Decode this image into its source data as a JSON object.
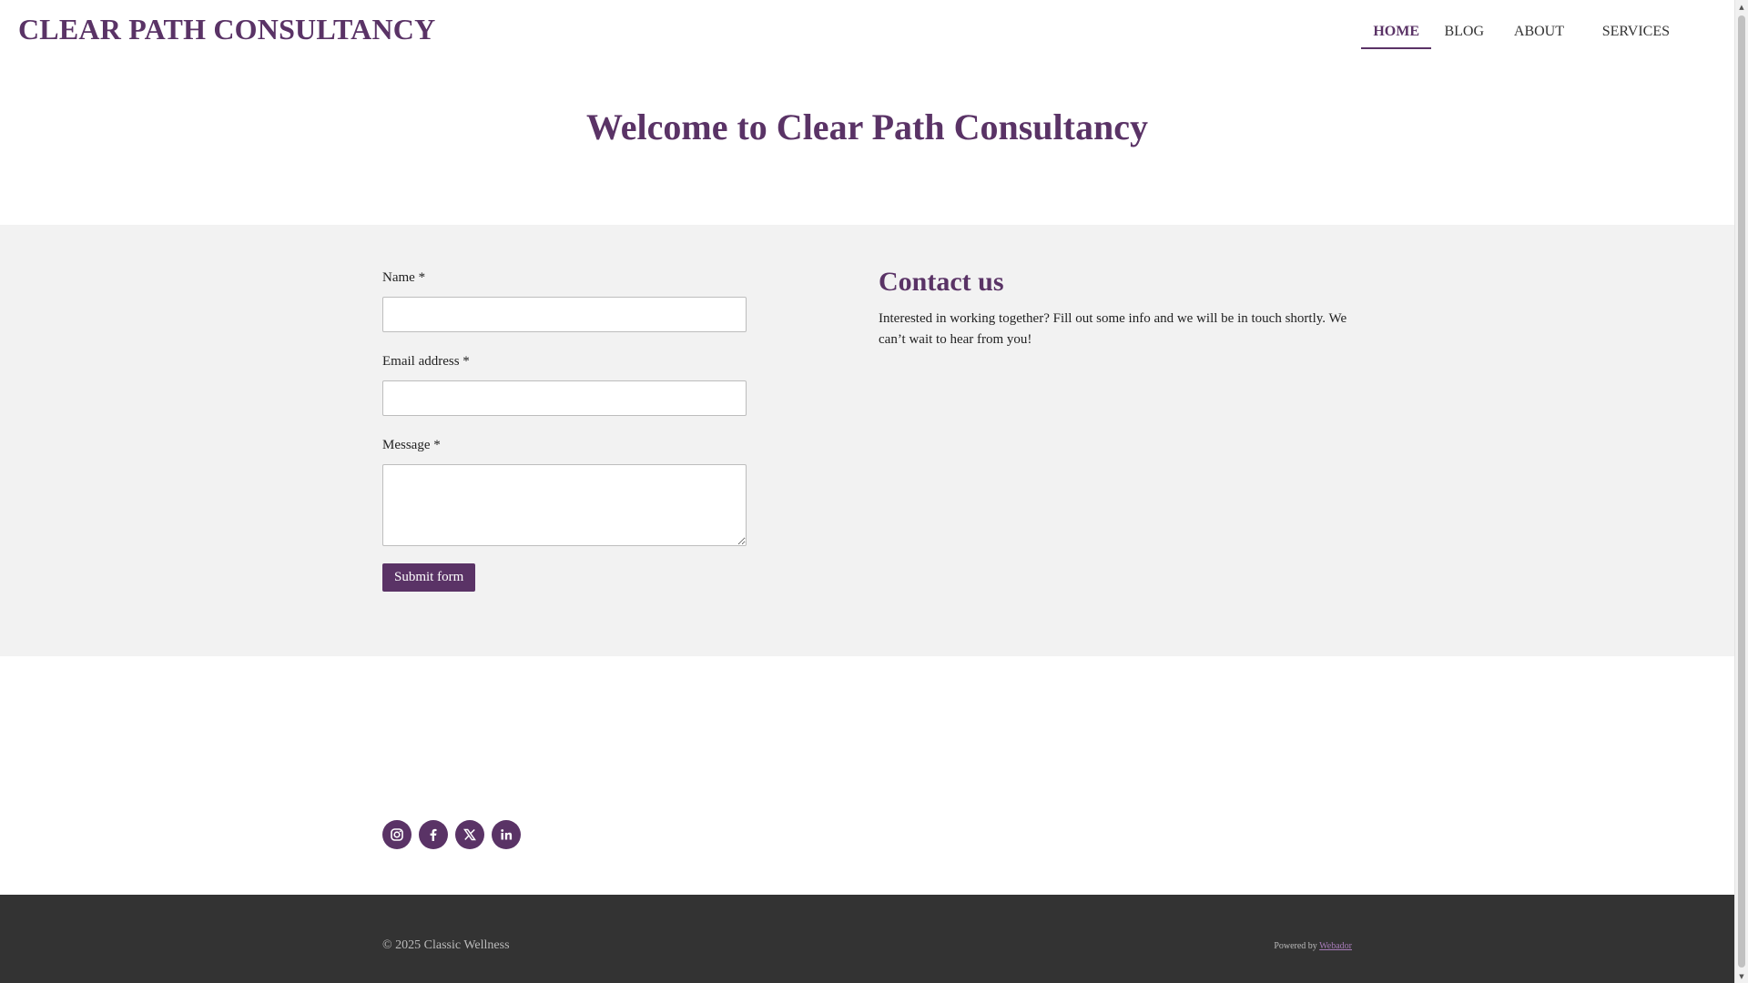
{
  "header": {
    "logo": "CLEAR PATH CONSULTANCY",
    "nav": [
      {
        "label": "HOME",
        "active": true
      },
      {
        "label": "BLOG",
        "active": false
      },
      {
        "label": "ABOUT",
        "active": false
      },
      {
        "label": "SERVICES",
        "active": false
      }
    ]
  },
  "hero": {
    "title": "Welcome to Clear Path Consultancy"
  },
  "contact": {
    "form": {
      "name_label": "Name *",
      "email_label": "Email address *",
      "message_label": "Message *",
      "submit_label": "Submit form"
    },
    "heading": "Contact us",
    "body": "Interested in working together? Fill out some info and we will be in touch shortly. We can’t wait to hear from you!"
  },
  "social": {
    "icons": [
      "instagram-icon",
      "facebook-icon",
      "twitter-icon",
      "linkedin-icon"
    ],
    "color": "#5a3366"
  },
  "footer": {
    "copyright": "© 2025 Classic Wellness",
    "powered_prefix": "Powered by",
    "powered_link": "Webador"
  },
  "colors": {
    "accent": "#5a3366",
    "section_bg": "#f2f2f2",
    "footer_bg": "#333333"
  }
}
